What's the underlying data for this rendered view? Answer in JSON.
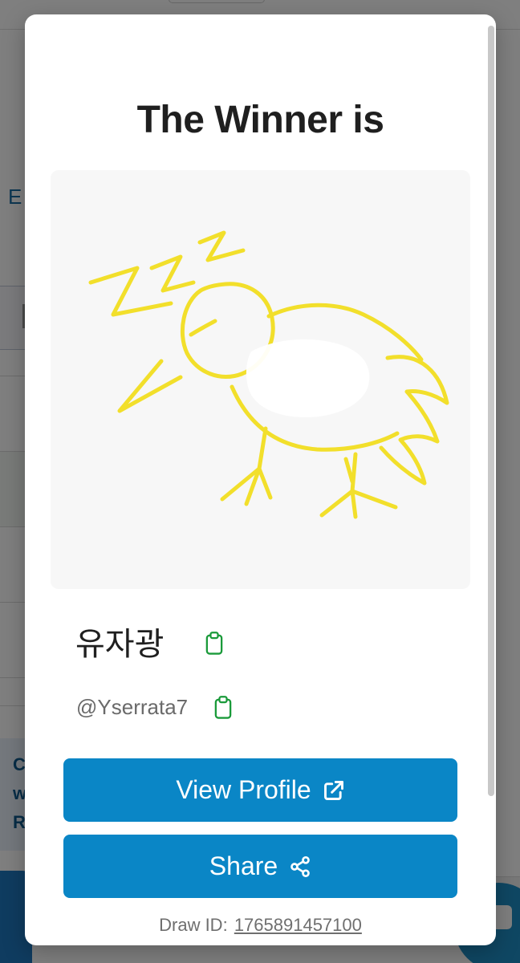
{
  "background": {
    "edge_text": "E",
    "info_lines": [
      "C",
      "w",
      "R"
    ]
  },
  "modal": {
    "title": "The Winner is",
    "drawing_icon": "bird-drawing",
    "winner_name": "유자광",
    "winner_handle": "@Yserrata7",
    "copy_icon": "clipboard-icon",
    "buttons": {
      "view_profile": "View Profile",
      "view_profile_icon": "external-link-icon",
      "share": "Share",
      "share_icon": "share-icon"
    },
    "draw_id_label": "Draw ID:",
    "draw_id_value": "1765891457100"
  },
  "colors": {
    "primary_button": "#0a86c6",
    "copy_icon_green": "#1a9a3a",
    "drawing_yellow": "#f2df2b"
  }
}
